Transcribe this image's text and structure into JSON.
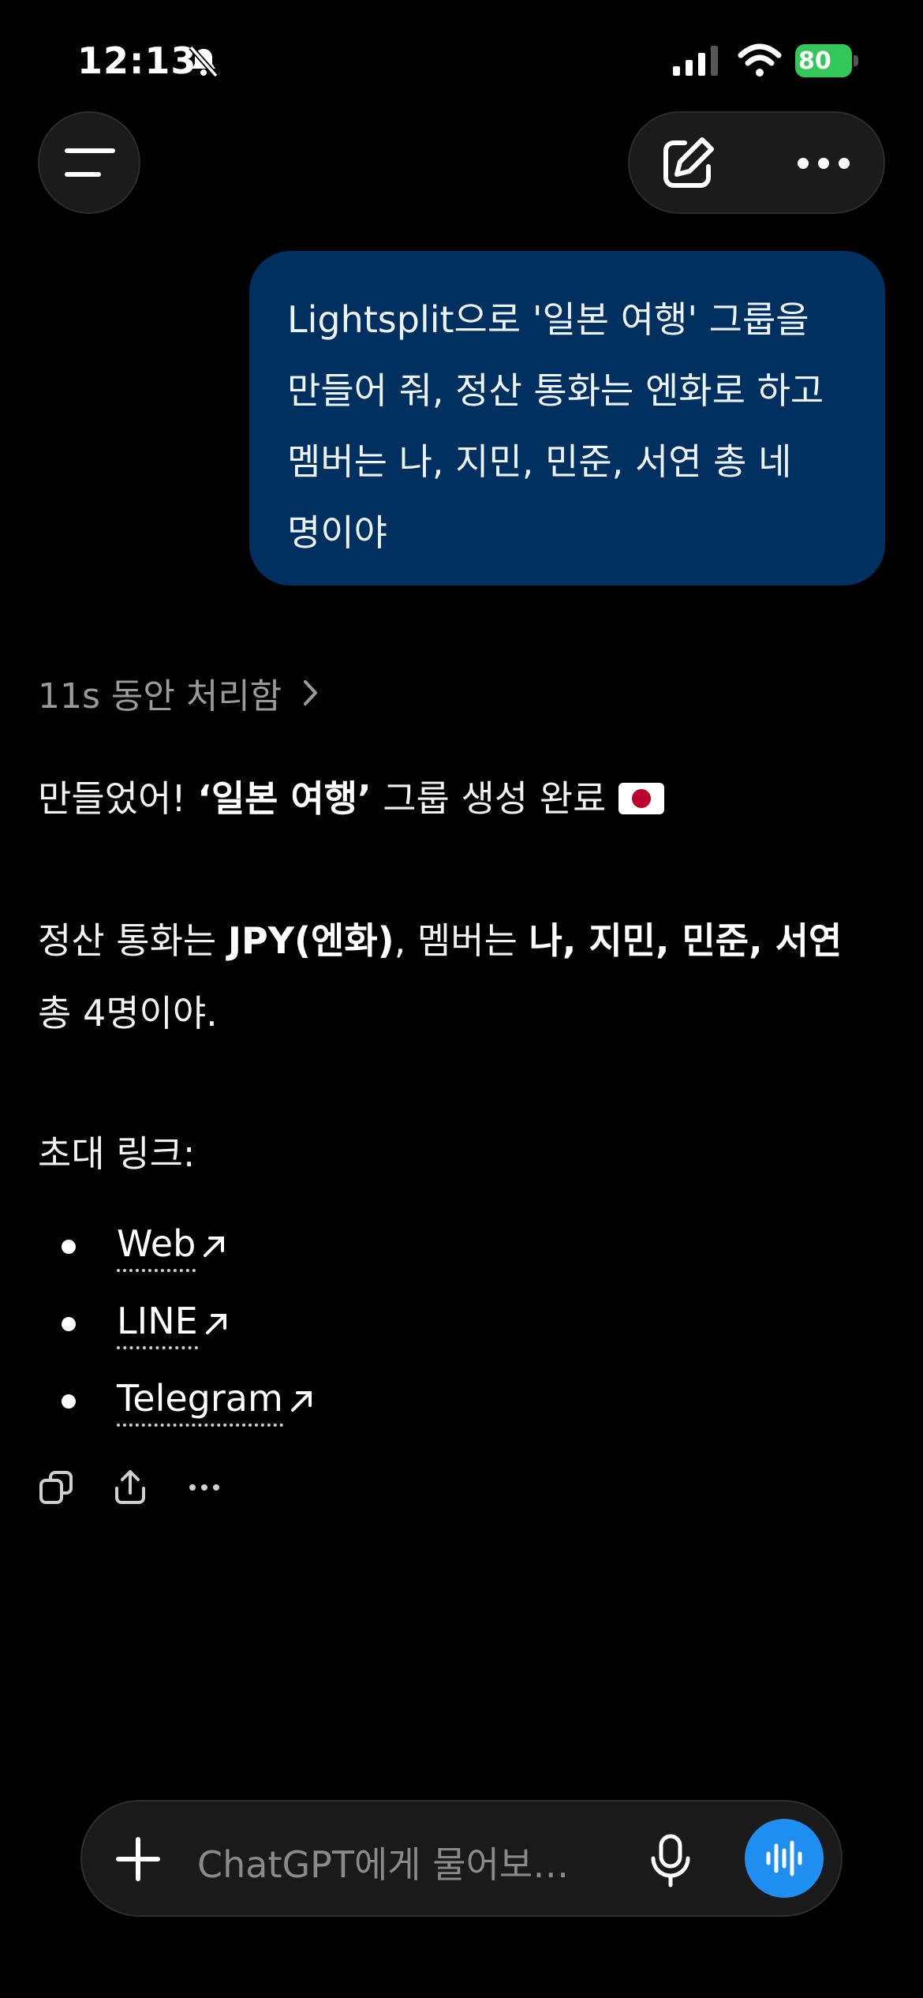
{
  "status_bar": {
    "time": "12:13",
    "battery": "80"
  },
  "header": {
    "menu_icon": "menu-icon",
    "new_chat_icon": "edit-icon",
    "more_icon": "more-icon"
  },
  "user_message": {
    "text": "Lightsplit으로 '일본 여행' 그룹을\n만들어 줘, 정산 통화는 엔화로 하고\n멤버는 나, 지민, 민준, 서연 총 네\n명이야"
  },
  "reasoning": {
    "label": "11s 동안 처리함"
  },
  "response": {
    "line1_prefix": "만들었어! ",
    "line1_bold": "‘일본 여행’",
    "line1_suffix": " 그룹 생성 완료",
    "line2_prefix": "정산 통화는 ",
    "line2_bold_currency": "JPY(엔화)",
    "line2_mid": ", 멤버는 ",
    "line2_bold_members": "나, 지민, 민준, 서연",
    "line3": "총 4명이야.",
    "invite_label": "초대 링크:",
    "links": [
      {
        "label": "Web"
      },
      {
        "label": "LINE"
      },
      {
        "label": "Telegram"
      }
    ]
  },
  "message_actions": [
    "copy-icon",
    "share-icon",
    "more-icon"
  ],
  "composer": {
    "placeholder": "ChatGPT에게 물어보…"
  },
  "colors": {
    "background": "#000000",
    "user_bubble": "#00305f",
    "voice_button": "#1f8ef1",
    "battery": "#33c759"
  }
}
